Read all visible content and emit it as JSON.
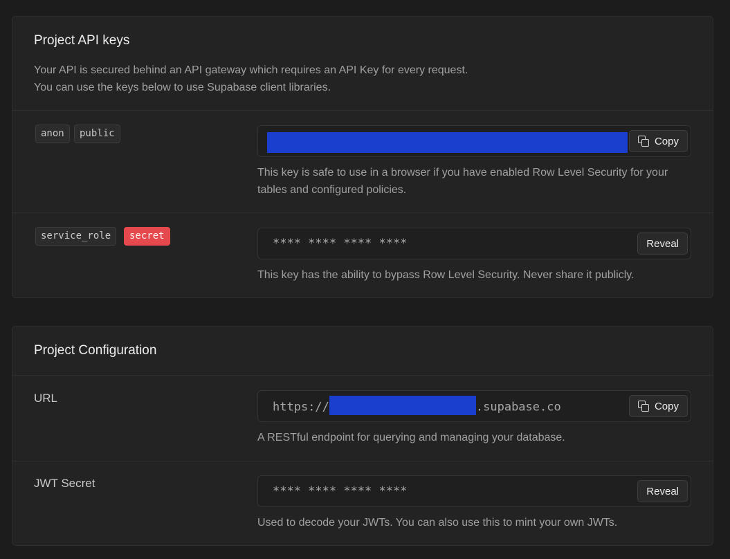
{
  "api_keys": {
    "title": "Project API keys",
    "description_line1": "Your API is secured behind an API gateway which requires an API Key for every request.",
    "description_line2": "You can use the keys below to use Supabase client libraries.",
    "anon": {
      "tags": [
        "anon",
        "public"
      ],
      "copy_label": "Copy",
      "help": "This key is safe to use in a browser if you have enabled Row Level Security for your tables and configured policies."
    },
    "service_role": {
      "tags": [
        "service_role",
        "secret"
      ],
      "masked_value": "**** **** **** ****",
      "reveal_label": "Reveal",
      "help": "This key has the ability to bypass Row Level Security. Never share it publicly."
    }
  },
  "config": {
    "title": "Project Configuration",
    "url": {
      "label": "URL",
      "prefix": "https://",
      "suffix": ".supabase.co",
      "copy_label": "Copy",
      "help": "A RESTful endpoint for querying and managing your database."
    },
    "jwt": {
      "label": "JWT Secret",
      "masked_value": "**** **** **** ****",
      "reveal_label": "Reveal",
      "help": "Used to decode your JWTs. You can also use this to mint your own JWTs."
    }
  },
  "colors": {
    "background": "#1c1c1c",
    "card": "#232323",
    "redaction": "#1a3fcf",
    "secret_badge": "#e5484d"
  },
  "icons": {
    "copy": "copy-icon"
  }
}
